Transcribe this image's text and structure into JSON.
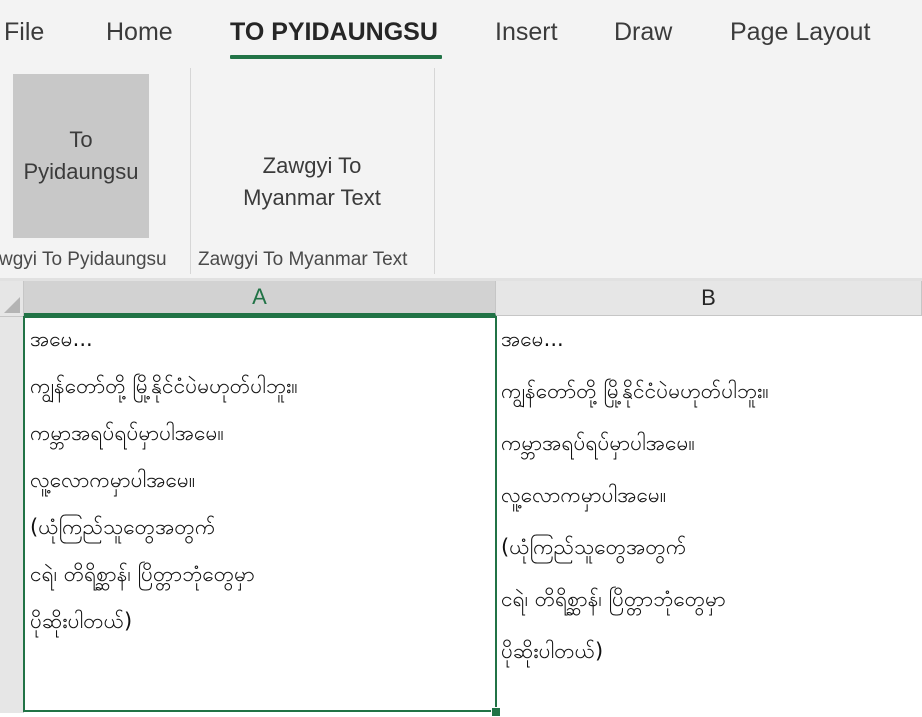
{
  "ribbon_tabs": [
    "File",
    "Home",
    "TO PYIDAUNGSU",
    "Insert",
    "Draw",
    "Page Layout"
  ],
  "active_tab": "TO PYIDAUNGSU",
  "groups": [
    {
      "button_line1": "To",
      "button_line2": "Pyidaungsu",
      "label": "wgyi To Pyidaungsu",
      "pressed": true
    },
    {
      "button_line1": "Zawgyi To",
      "button_line2": "Myanmar Text",
      "label": "Zawgyi To Myanmar Text",
      "pressed": false
    }
  ],
  "columns": [
    "A",
    "B"
  ],
  "selected_column": "A",
  "cells": {
    "A": [
      "အမေ...",
      "ကျွန်တော်တို့ မြို့နိုင်ငံပဲမဟုတ်ပါဘူး။",
      "ကမ္ဘာအရပ်ရပ်မှာပါအမေ။",
      "လူ့လောကမှာပါအမေ။",
      "(ယုံကြည်သူတွေအတွက်",
      "ငရဲ၊ တိရိစ္ဆာန်၊ ပြိတ္တာဘုံတွေမှာ",
      "ပိုဆိုးပါတယ်)"
    ],
    "B": [
      "အမေ...",
      "ကျွန်တော်တို့ မြို့နိုင်ငံပဲမဟုတ်ပါဘူး။",
      "ကမ္ဘာအရပ်ရပ်မှာပါအမေ။",
      "လူ့လောကမှာပါအမေ။",
      "(ယုံကြည်သူတွေအတွက်",
      "ငရဲ၊ တိရိစ္ဆာန်၊ ပြိတ္တာဘုံတွေမှာ",
      "ပိုဆိုးပါတယ်)"
    ]
  },
  "colors": {
    "accent": "#217346",
    "ribbon_bg": "#f3f3f3",
    "header_bg": "#e6e6e6",
    "pressed_bg": "#c8c8c8"
  }
}
